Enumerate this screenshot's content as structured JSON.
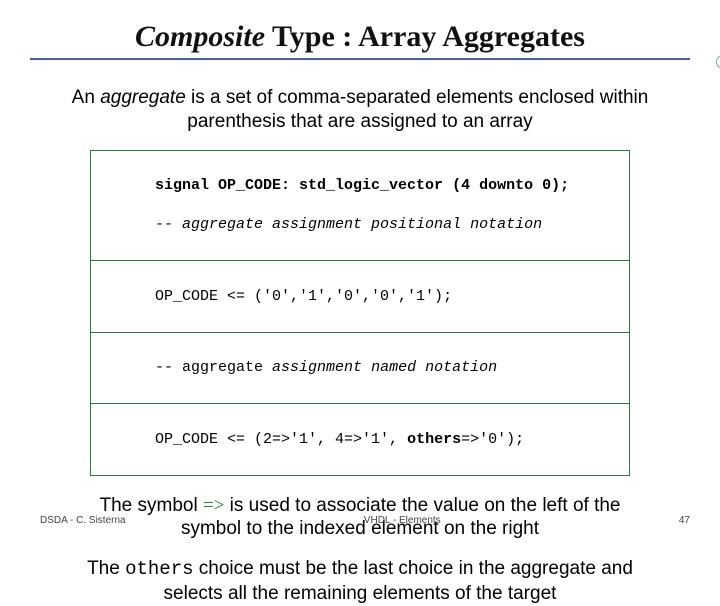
{
  "title": {
    "part1": "Composite",
    "part2": " Type : Array Aggregates"
  },
  "intro": {
    "pre": "An ",
    "word": "aggregate",
    "post": " is a set of comma-separated elements enclosed within parenthesis that are assigned to an array"
  },
  "code": {
    "row1a": "signal OP_CODE: std_logic_vector (4 downto 0);",
    "row1b": "-- aggregate assignment positional notation",
    "row2": "OP_CODE <= ('0','1','0','0','1');",
    "row3pre": "-- aggregate ",
    "row3it": "assignment named notation",
    "row4a": "OP_CODE <= (2=>'1', 4=>'1', ",
    "row4kw": "others",
    "row4b": "=>'0');"
  },
  "para_symbol": {
    "pre": "The symbol ",
    "sym": "=>",
    "post": " is used to  associate the value on the left of the symbol to the indexed element on the right"
  },
  "para_others": {
    "pre": "The ",
    "word": "others",
    "post": " choice must be the last choice in the aggregate and selects all the remaining elements of the target"
  },
  "footer": {
    "left": "DSDA - C. Sisterna",
    "center": "VHDL - Elements",
    "page": "47"
  }
}
